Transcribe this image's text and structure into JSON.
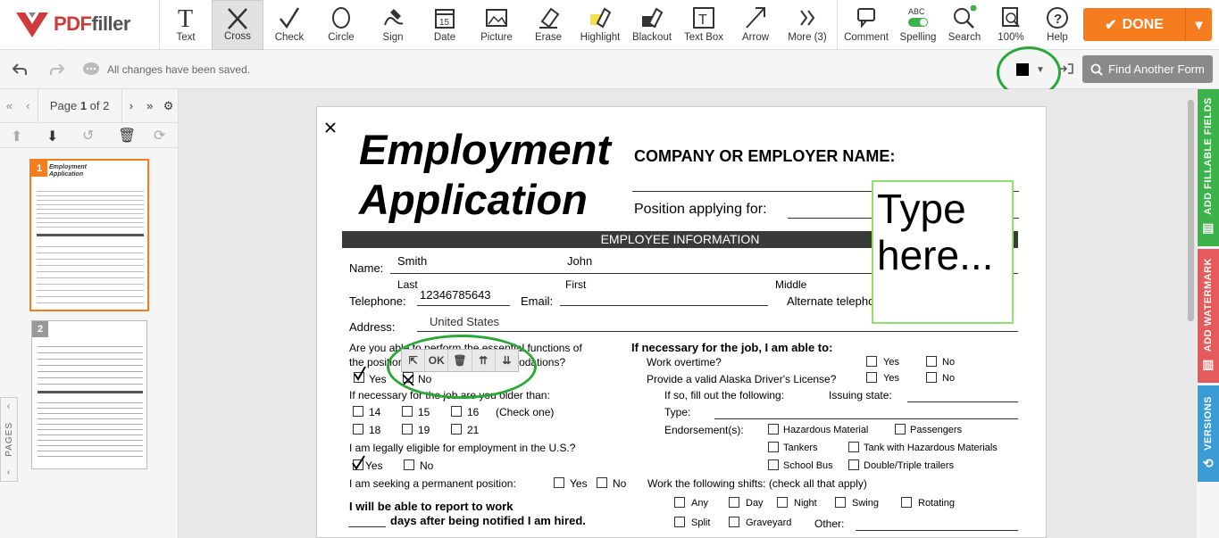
{
  "app": {
    "logo_main": "PDF",
    "logo_rest": "filler"
  },
  "toolbar": {
    "tools": [
      "Text",
      "Cross",
      "Check",
      "Circle",
      "Sign",
      "Date",
      "Picture",
      "Erase",
      "Highlight",
      "Blackout",
      "Text Box",
      "Arrow",
      "More (3)"
    ],
    "active_tool": "Cross",
    "right_tools": [
      "Comment",
      "Spelling",
      "Search",
      "100%",
      "Help"
    ],
    "spelling_badge": "ABC",
    "done_label": "DONE"
  },
  "subbar": {
    "saved_text": "All changes have been saved.",
    "find_label": "Find Another Form",
    "current_color": "#000000"
  },
  "sidebar": {
    "page_label_pre": "Page ",
    "page_current": "1",
    "page_label_post": " of 2",
    "pages_tab": "PAGES",
    "thumb1_num": "1",
    "thumb2_num": "2",
    "thumb1_title": "Employment Application"
  },
  "right_tabs": {
    "fillable": "ADD FILLABLE FIELDS",
    "watermark": "ADD WATERMARK",
    "versions": "VERSIONS"
  },
  "doc": {
    "title1": "Employment",
    "title2": "Application",
    "company_label": "COMPANY OR EMPLOYER NAME:",
    "position_label": "Position applying for:",
    "section_header": "EMPLOYEE INFORMATION",
    "name_label": "Name:",
    "last_value": "Smith",
    "first_value": "John",
    "last_label": "Last",
    "first_label": "First",
    "middle_label": "Middle",
    "telephone_label": "Telephone:",
    "telephone_value": "12346785643",
    "email_label": "Email:",
    "alt_phone_label": "Alternate telephone:",
    "address_label": "Address:",
    "address_value": "United States",
    "q_essential_1": "Are you able to perform the essential functions of",
    "q_essential_2": "the position with or without accommodations?",
    "yes": "Yes",
    "no": "No",
    "q_older": "If necessary for the job are you older than:",
    "ages": [
      "14",
      "15",
      "16",
      "18",
      "19",
      "21"
    ],
    "check_one": "(Check one)",
    "q_eligible": "I am legally eligible for employment in the U.S.?",
    "q_permanent": "I am seeking a permanent position:",
    "report_1": "I will be able to report to work",
    "report_2": "days after being notified I am hired.",
    "able_header": "If necessary for the job, I am able to:",
    "overtime": "Work overtime?",
    "alaska": "Provide a valid Alaska Driver's License?",
    "fill_following": "If so, fill out the following:",
    "issuing_state": "Issuing state:",
    "type_label": "Type:",
    "endorsements": "Endorsement(s):",
    "endorse_items": [
      "Hazardous Material",
      "Passengers",
      "Tankers",
      "Tank with Hazardous Materials",
      "School Bus",
      "Double/Triple trailers"
    ],
    "shifts_label": "Work the following shifts: (check all that apply)",
    "shifts": [
      "Any",
      "Day",
      "Night",
      "Swing",
      "Rotating",
      "Split",
      "Graveyard"
    ],
    "other_label": "Other:",
    "type_here": "Type here..."
  },
  "mini_toolbar": {
    "ok": "OK"
  }
}
